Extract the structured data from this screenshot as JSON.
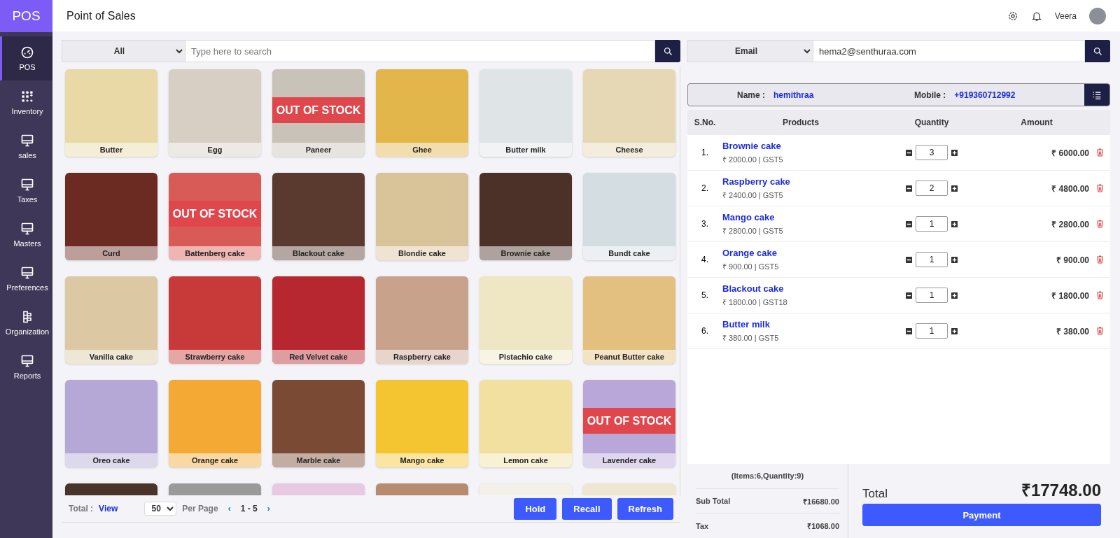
{
  "app": {
    "logo": "POS",
    "title": "Point of Sales",
    "user": "Veera"
  },
  "sidebar": [
    {
      "label": "POS",
      "selected": true
    },
    {
      "label": "Inventory",
      "selected": false
    },
    {
      "label": "sales",
      "selected": false
    },
    {
      "label": "Taxes",
      "selected": false
    },
    {
      "label": "Masters",
      "selected": false
    },
    {
      "label": "Preferences",
      "selected": false
    },
    {
      "label": "Organization",
      "selected": false
    },
    {
      "label": "Reports",
      "selected": false
    }
  ],
  "catalog": {
    "category": "All",
    "search_placeholder": "Type here to search",
    "products": [
      {
        "kind": "product",
        "name": "Butter"
      },
      {
        "kind": "product",
        "name": "Egg"
      },
      {
        "kind": "product",
        "name": "Paneer",
        "banner": "OUT OF STOCK"
      },
      {
        "kind": "product",
        "name": "Ghee"
      },
      {
        "kind": "product",
        "name": "Butter milk"
      },
      {
        "kind": "product",
        "name": "Cheese"
      },
      {
        "kind": "product",
        "name": "Curd"
      },
      {
        "kind": "product",
        "name": "Battenberg cake",
        "banner": "OUT OF STOCK"
      },
      {
        "kind": "product",
        "name": "Blackout cake"
      },
      {
        "kind": "product",
        "name": "Blondie cake"
      },
      {
        "kind": "product",
        "name": "Brownie cake"
      },
      {
        "kind": "product",
        "name": "Bundt cake"
      },
      {
        "kind": "product",
        "name": "Vanilla cake"
      },
      {
        "kind": "product",
        "name": "Strawberry cake"
      },
      {
        "kind": "product",
        "name": "Red Velvet cake"
      },
      {
        "kind": "product",
        "name": "Raspberry cake"
      },
      {
        "kind": "product",
        "name": "Pistachio cake"
      },
      {
        "kind": "product",
        "name": "Peanut Butter cake"
      },
      {
        "kind": "product",
        "name": "Oreo cake"
      },
      {
        "kind": "product",
        "name": "Orange cake"
      },
      {
        "kind": "product",
        "name": "Marble cake"
      },
      {
        "kind": "product",
        "name": "Mango cake"
      },
      {
        "kind": "product",
        "name": "Lemon cake"
      },
      {
        "kind": "product",
        "name": "Lavender cake",
        "banner": "OUT OF STOCK"
      },
      {
        "kind": "cut"
      },
      {
        "kind": "cut"
      },
      {
        "kind": "cut"
      },
      {
        "kind": "cut"
      },
      {
        "kind": "cut"
      },
      {
        "kind": "cut"
      }
    ],
    "footer": {
      "total_label": "Total :",
      "view_link": "View",
      "page_size": "50",
      "per_page": "Per Page",
      "prev": "‹",
      "range": "1 - 5",
      "next": "›"
    },
    "buttons": [
      "Hold",
      "Recall",
      "Refresh"
    ]
  },
  "customer": {
    "lookup_type": "Email",
    "lookup_value": "hema2@senthuraa.com",
    "name_label": "Name :",
    "name": "hemithraa",
    "mobile_label": "Mobile :",
    "mobile": "+919360712992"
  },
  "cart": {
    "columns": [
      "S.No.",
      "Products",
      "Quantity",
      "Amount"
    ],
    "rows": [
      {
        "sno": "1.",
        "name": "Brownie cake",
        "price": "₹ 2000.00 | GST5",
        "qty": "3",
        "amount": "₹ 6000.00"
      },
      {
        "sno": "2.",
        "name": "Raspberry cake",
        "price": "₹ 2400.00 | GST5",
        "qty": "2",
        "amount": "₹ 4800.00"
      },
      {
        "sno": "3.",
        "name": "Mango cake",
        "price": "₹ 2800.00 | GST5",
        "qty": "1",
        "amount": "₹ 2800.00"
      },
      {
        "sno": "4.",
        "name": "Orange cake",
        "price": "₹ 900.00 | GST5",
        "qty": "1",
        "amount": "₹ 900.00"
      },
      {
        "sno": "5.",
        "name": "Blackout cake",
        "price": "₹ 1800.00 | GST18",
        "qty": "1",
        "amount": "₹ 1800.00"
      },
      {
        "sno": "6.",
        "name": "Butter milk",
        "price": "₹ 380.00 | GST5",
        "qty": "1",
        "amount": "₹ 380.00"
      }
    ]
  },
  "summary": {
    "counts": "(Items:6,Quantity:9)",
    "sub_total_label": "Sub Total",
    "sub_total": "₹16680.00",
    "tax_label": "Tax",
    "tax": "₹1068.00",
    "total_label": "Total",
    "total": "₹17748.00",
    "payment": "Payment"
  }
}
